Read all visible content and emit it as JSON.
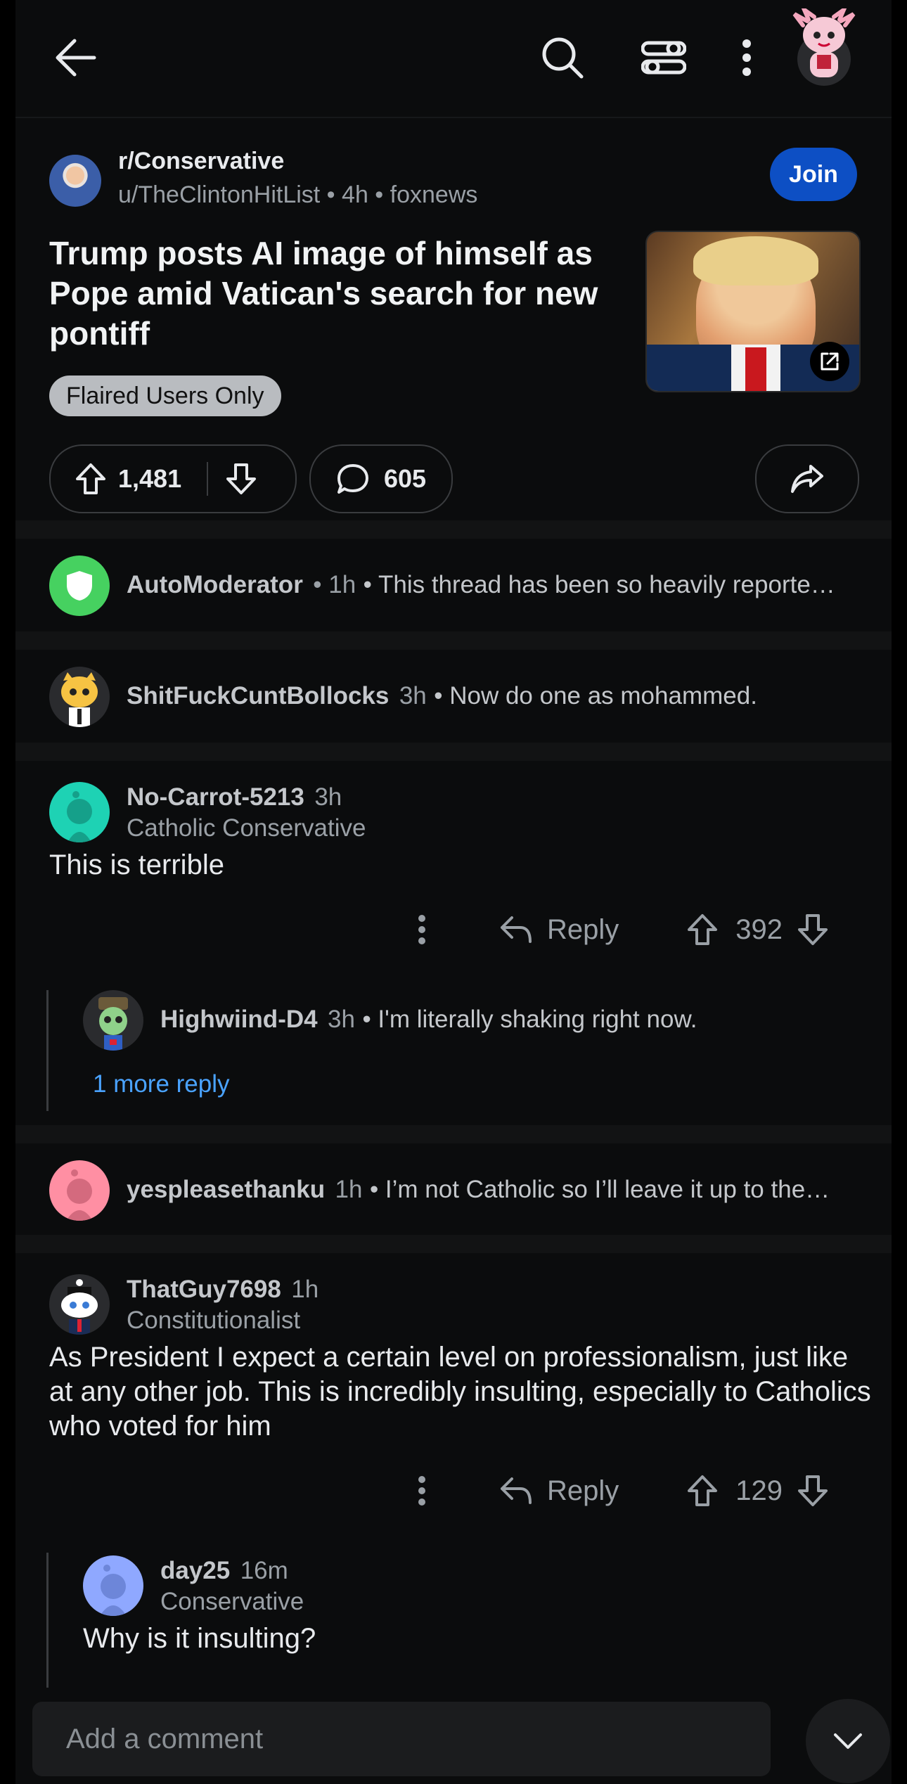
{
  "post": {
    "subreddit": "r/Conservative",
    "meta": "u/TheClintonHitList • 4h • foxnews",
    "join_label": "Join",
    "title": "Trump posts AI image of himself as Pope amid Vatican's search for new pontiff",
    "flair": "Flaired Users Only",
    "upvotes": "1,481",
    "comments": "605"
  },
  "comments": [
    {
      "author": "AutoModerator",
      "time": "• 1h",
      "preview": "• This thread has been so heavily reporte…",
      "avatar_color": "#46d160"
    },
    {
      "author": "ShitFuckCuntBollocks",
      "time": "3h",
      "preview": "• Now do one as mohammed."
    },
    {
      "author": "No-Carrot-5213",
      "time": "3h",
      "flair": "Catholic Conservative",
      "body": "This is terrible",
      "reply_label": "Reply",
      "score": "392",
      "avatar_color": "#1ed2b4",
      "child": {
        "author": "Highwiind-D4",
        "time": "3h",
        "preview": "• I'm literally shaking right now.",
        "more": "1 more reply"
      }
    },
    {
      "author": "yespleasethanku",
      "time": "1h",
      "preview": "• I’m not Catholic so I’ll leave it up to the…",
      "avatar_color": "#ff8fa3"
    },
    {
      "author": "ThatGuy7698",
      "time": "1h",
      "flair": "Constitutionalist",
      "body": "As President I expect a certain level on professionalism, just like at any other job. This is incredibly insulting, especially to Catholics who voted for him",
      "reply_label": "Reply",
      "score": "129",
      "child": {
        "author": "day25",
        "time": "16m",
        "flair": "Conservative",
        "body": "Why is it insulting?",
        "avatar_color": "#8fa8ff"
      }
    }
  ],
  "composer": {
    "placeholder": "Add a comment"
  }
}
